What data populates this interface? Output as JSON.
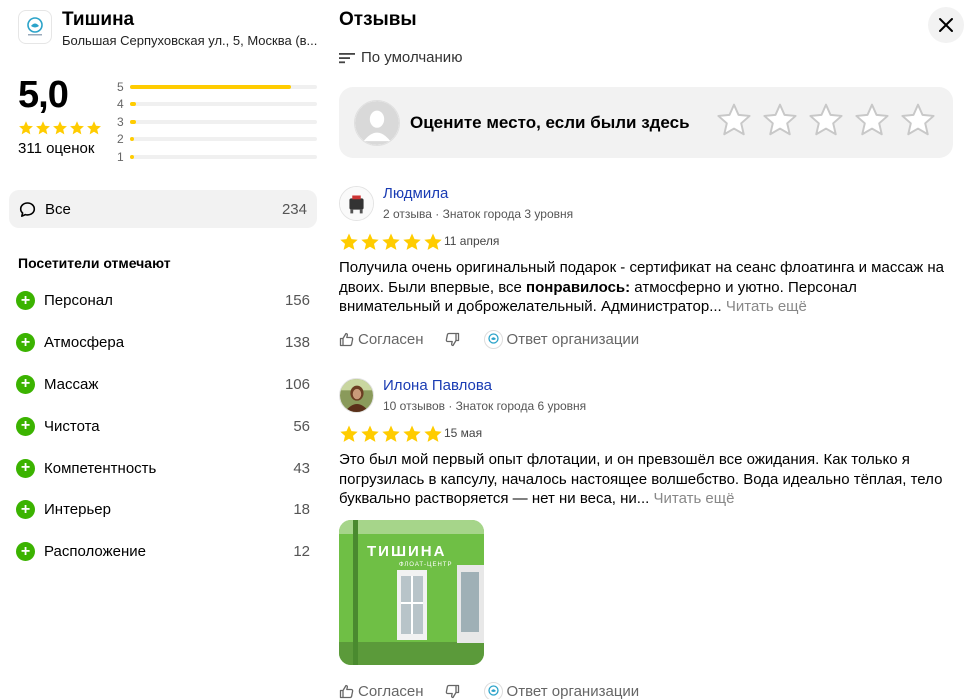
{
  "organization": {
    "name": "Тишина",
    "address": "Большая Серпуховская ул., 5, Москва (в...",
    "logo_icon": "tishina-logo-icon"
  },
  "rating": {
    "value": "5,0",
    "stars": 5,
    "count_label": "311 оценок",
    "distribution": [
      {
        "label": "5",
        "fraction": 0.86
      },
      {
        "label": "4",
        "fraction": 0.03
      },
      {
        "label": "3",
        "fraction": 0.03
      },
      {
        "label": "2",
        "fraction": 0.015
      },
      {
        "label": "1",
        "fraction": 0.015
      }
    ]
  },
  "filters": {
    "all": {
      "label": "Все",
      "count": "234",
      "icon": "speech-bubble-icon"
    }
  },
  "visitors": {
    "title": "Посетители отмечают",
    "tags": [
      {
        "label": "Персонал",
        "count": "156"
      },
      {
        "label": "Атмосфера",
        "count": "138"
      },
      {
        "label": "Массаж",
        "count": "106"
      },
      {
        "label": "Чистота",
        "count": "56"
      },
      {
        "label": "Компетентность",
        "count": "43"
      },
      {
        "label": "Интерьер",
        "count": "18"
      },
      {
        "label": "Расположение",
        "count": "12"
      }
    ]
  },
  "reviews_panel": {
    "title": "Отзывы",
    "sort_label": "По умолчанию",
    "rate_prompt": "Оцените место, если были здесь"
  },
  "reviews": [
    {
      "author": "Людмила",
      "meta": "2 отзыва · Знаток города 3 уровня",
      "stars": 5,
      "date": "11 апреля",
      "text_before": "Получила очень оригинальный подарок - сертификат на сеанс флоатинга и массаж на двоих. Были впервые, все ",
      "text_bold": "понравилось:",
      "text_after": " атмосферно и уютно. Персонал внимательный и доброжелательный. Администратор...",
      "more": "Читать ещё",
      "agree": "Согласен",
      "org_reply": "Ответ организации"
    },
    {
      "author": "Илона Павлова",
      "meta": "10 отзывов · Знаток города 6 уровня",
      "stars": 5,
      "date": "15 мая",
      "text_before": "Это был мой первый опыт флотации, и он превзошёл все ожидания. Как только я погрузилась в капсулу, началось настоящее волшебство. Вода идеально тёплая, тело буквально растворяется — нет ни веса, ни...",
      "text_bold": "",
      "text_after": "",
      "more": "Читать ещё",
      "photo_sign": "ТИШИНА",
      "photo_subsign": "ФЛОАТ-ЦЕНТР",
      "agree": "Согласен",
      "org_reply": "Ответ организации"
    }
  ],
  "colors": {
    "star": "#ffcc00",
    "accent_green": "#3bb300",
    "author_link": "#1a3cb3",
    "building_green": "#6fbf45"
  }
}
